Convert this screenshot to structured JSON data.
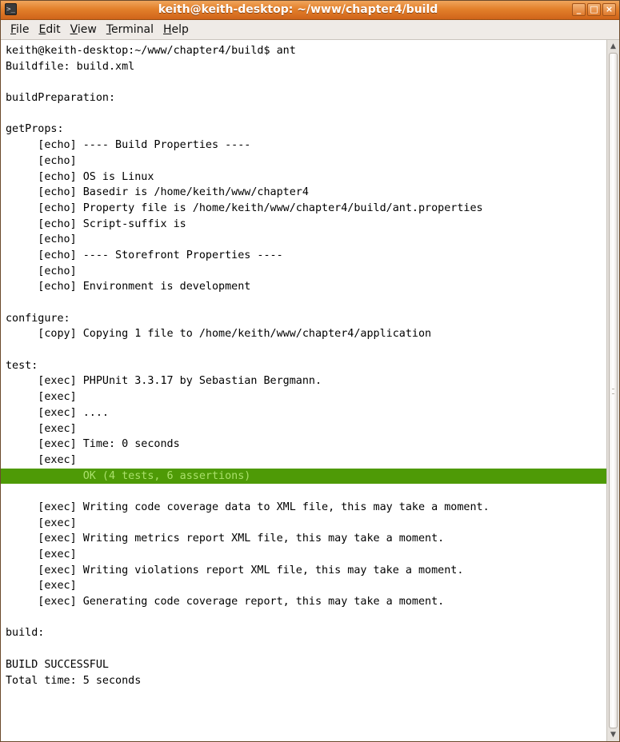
{
  "window": {
    "title": "keith@keith-desktop: ~/www/chapter4/build",
    "icon": "terminal-icon",
    "controls": {
      "minimize": "_",
      "maximize": "□",
      "close": "×"
    }
  },
  "menu": [
    {
      "mnemonic": "F",
      "rest": "ile"
    },
    {
      "mnemonic": "E",
      "rest": "dit"
    },
    {
      "mnemonic": "V",
      "rest": "iew"
    },
    {
      "mnemonic": "T",
      "rest": "erminal"
    },
    {
      "mnemonic": "H",
      "rest": "elp"
    }
  ],
  "terminal": {
    "lines": [
      "keith@keith-desktop:~/www/chapter4/build$ ant",
      "Buildfile: build.xml",
      "",
      "buildPreparation:",
      "",
      "getProps:",
      "     [echo] ---- Build Properties ----",
      "     [echo]",
      "     [echo] OS is Linux",
      "     [echo] Basedir is /home/keith/www/chapter4",
      "     [echo] Property file is /home/keith/www/chapter4/build/ant.properties",
      "     [echo] Script-suffix is",
      "     [echo]",
      "     [echo] ---- Storefront Properties ----",
      "     [echo]",
      "     [echo] Environment is development",
      "",
      "configure:",
      "     [copy] Copying 1 file to /home/keith/www/chapter4/application",
      "",
      "test:",
      "     [exec] PHPUnit 3.3.17 by Sebastian Bergmann.",
      "     [exec]",
      "     [exec] ....",
      "     [exec]",
      "     [exec] Time: 0 seconds",
      "     [exec]",
      "            OK (4 tests, 6 assertions)",
      "",
      "     [exec] Writing code coverage data to XML file, this may take a moment.",
      "     [exec]",
      "     [exec] Writing metrics report XML file, this may take a moment.",
      "     [exec]",
      "     [exec] Writing violations report XML file, this may take a moment.",
      "     [exec]",
      "     [exec] Generating code coverage report, this may take a moment.",
      "",
      "build:",
      "",
      "BUILD SUCCESSFUL",
      "Total time: 5 seconds"
    ],
    "highlight_line": 27,
    "colors": {
      "background": "#ffffff",
      "text": "#000000",
      "ok_background": "#4e9a06",
      "ok_text": "#a9e06a"
    }
  }
}
